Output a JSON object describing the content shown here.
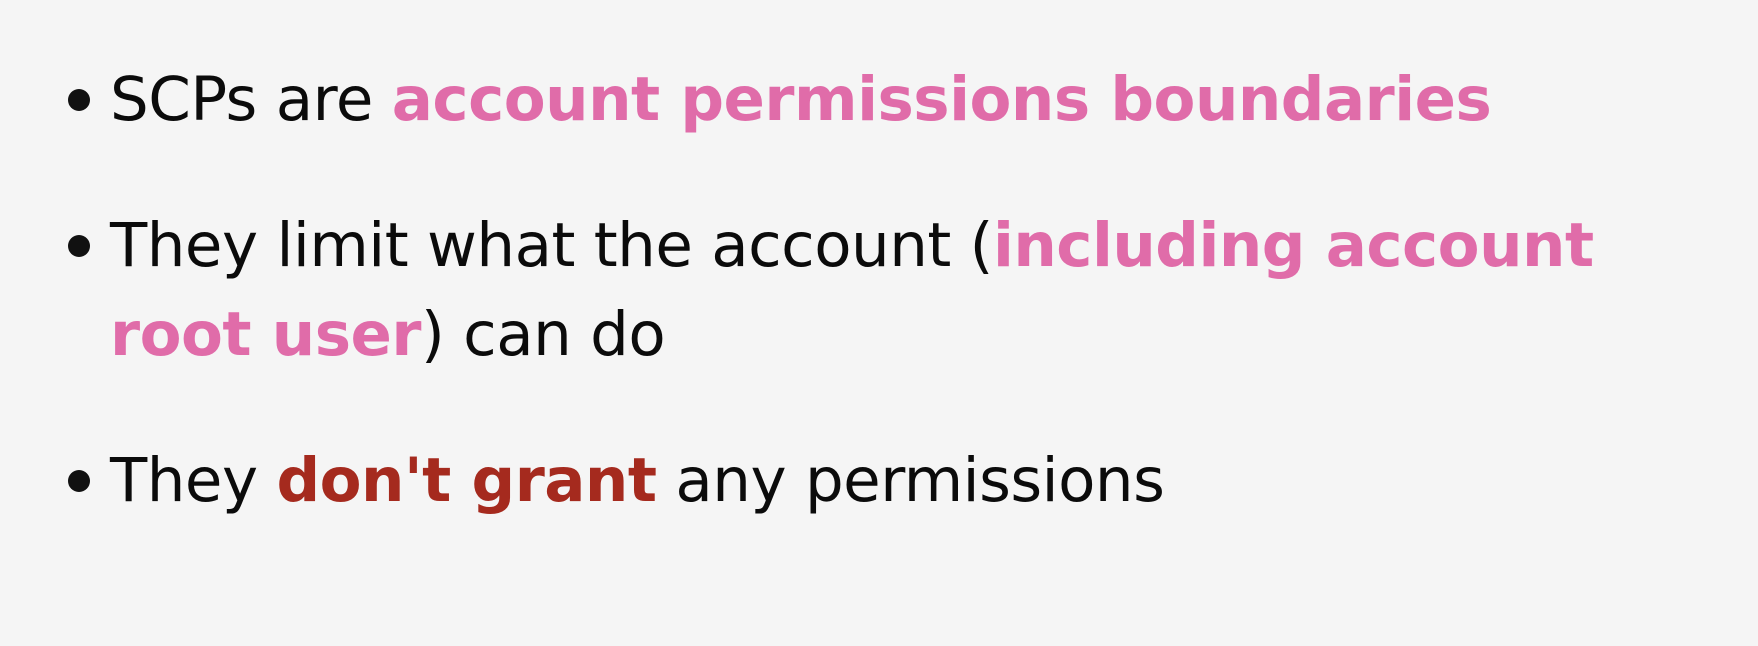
{
  "colors": {
    "background": "#f5f5f5",
    "text": "#0b0b0b",
    "highlight_pink": "#e06ca9",
    "highlight_red": "#a52a1e"
  },
  "slide": {
    "bullets": [
      {
        "prefix": "SCPs are ",
        "highlight": "account permissions boundaries"
      },
      {
        "prefix": "They limit what the account (",
        "highlight": "including account root user",
        "suffix": ") can do"
      },
      {
        "prefix": "They ",
        "highlight": "don't grant",
        "suffix": " any permissions"
      }
    ]
  }
}
